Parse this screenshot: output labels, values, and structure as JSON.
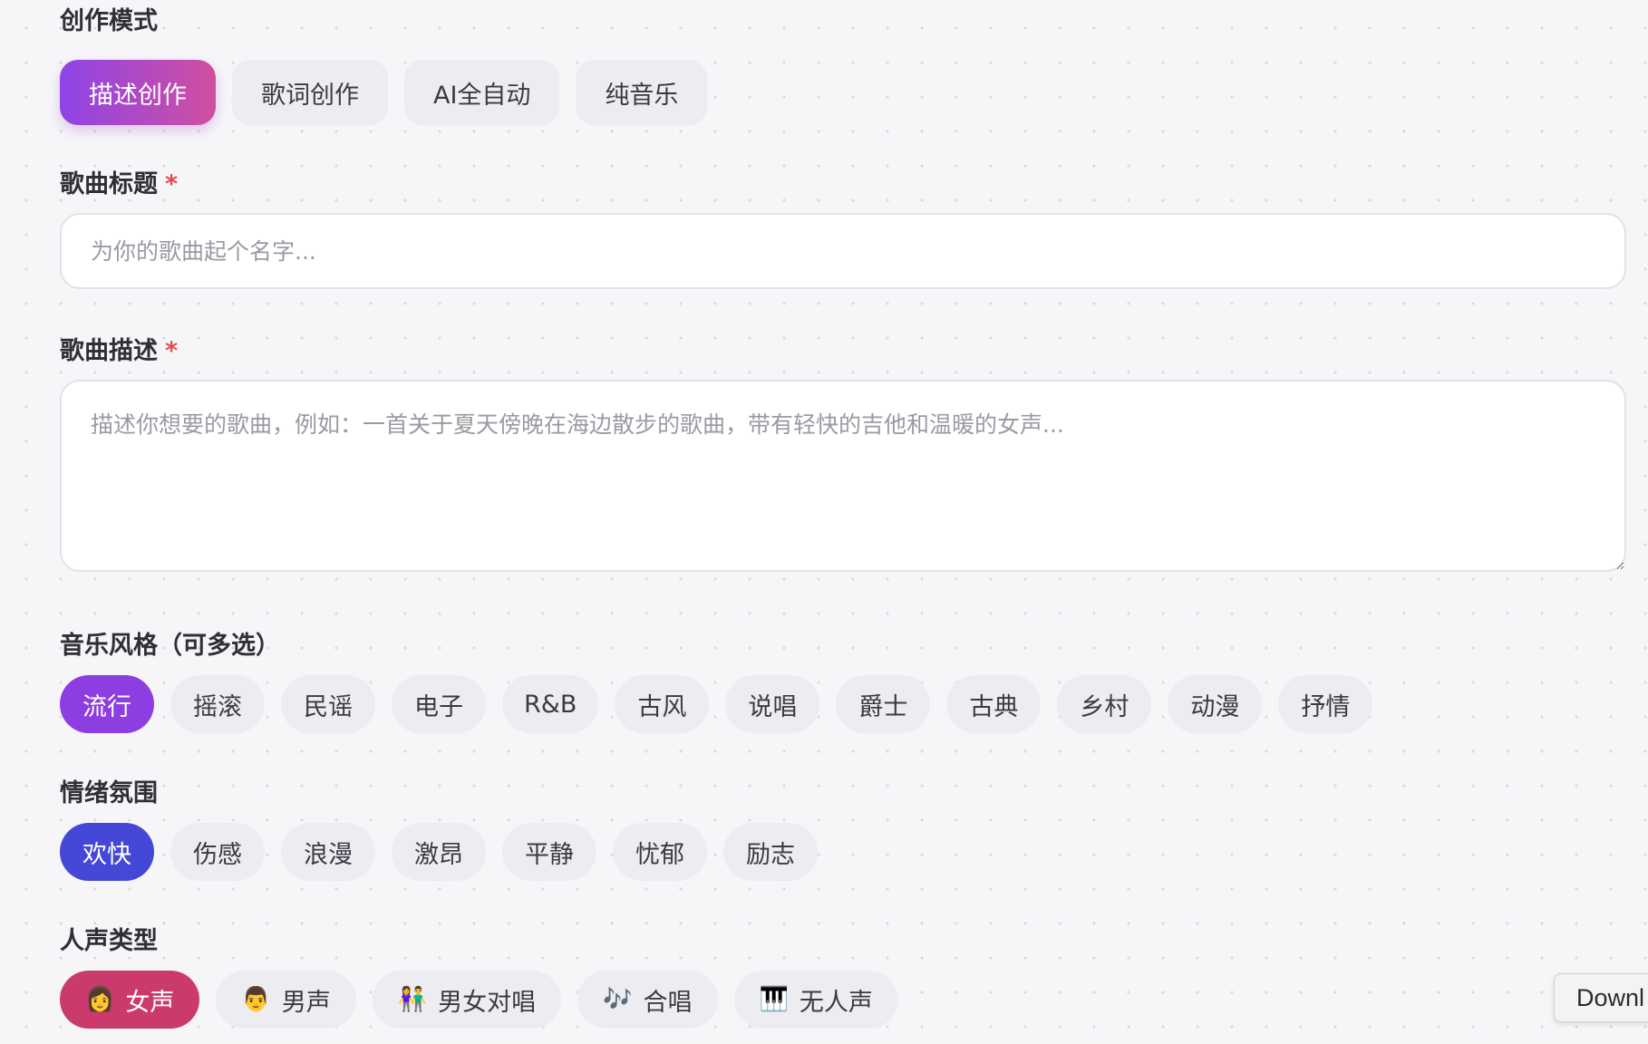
{
  "mode": {
    "label": "创作模式",
    "options": [
      "描述创作",
      "歌词创作",
      "AI全自动",
      "纯音乐"
    ],
    "selected_index": 0
  },
  "title": {
    "label": "歌曲标题",
    "required_mark": "*",
    "placeholder": "为你的歌曲起个名字...",
    "value": ""
  },
  "description": {
    "label": "歌曲描述",
    "required_mark": "*",
    "placeholder": "描述你想要的歌曲，例如：一首关于夏天傍晚在海边散步的歌曲，带有轻快的吉他和温暖的女声...",
    "value": ""
  },
  "style": {
    "label": "音乐风格（可多选）",
    "options": [
      "流行",
      "摇滚",
      "民谣",
      "电子",
      "R&B",
      "古风",
      "说唱",
      "爵士",
      "古典",
      "乡村",
      "动漫",
      "抒情"
    ],
    "selected": [
      "流行"
    ]
  },
  "mood": {
    "label": "情绪氛围",
    "options": [
      "欢快",
      "伤感",
      "浪漫",
      "激昂",
      "平静",
      "忧郁",
      "励志"
    ],
    "selected": [
      "欢快"
    ]
  },
  "voice": {
    "label": "人声类型",
    "options": [
      {
        "icon": "👩",
        "icon_name": "woman-icon",
        "label": "女声"
      },
      {
        "icon": "👨",
        "icon_name": "man-icon",
        "label": "男声"
      },
      {
        "icon": "👫",
        "icon_name": "couple-icon",
        "label": "男女对唱"
      },
      {
        "icon": "🎶",
        "icon_name": "music-notes-icon",
        "label": "合唱"
      },
      {
        "icon": "🎹",
        "icon_name": "piano-icon",
        "label": "无人声"
      }
    ],
    "selected_index": 0
  },
  "download_tab": {
    "label": "Downl"
  },
  "colors": {
    "mode_active_gradient_start": "#8e44e6",
    "mode_active_gradient_end": "#d04fa0",
    "style_active": "#8d3ee0",
    "mood_active": "#4547d6",
    "voice_active": "#cb3a6c",
    "required": "#e5484d",
    "chip_bg": "#ededf1"
  }
}
